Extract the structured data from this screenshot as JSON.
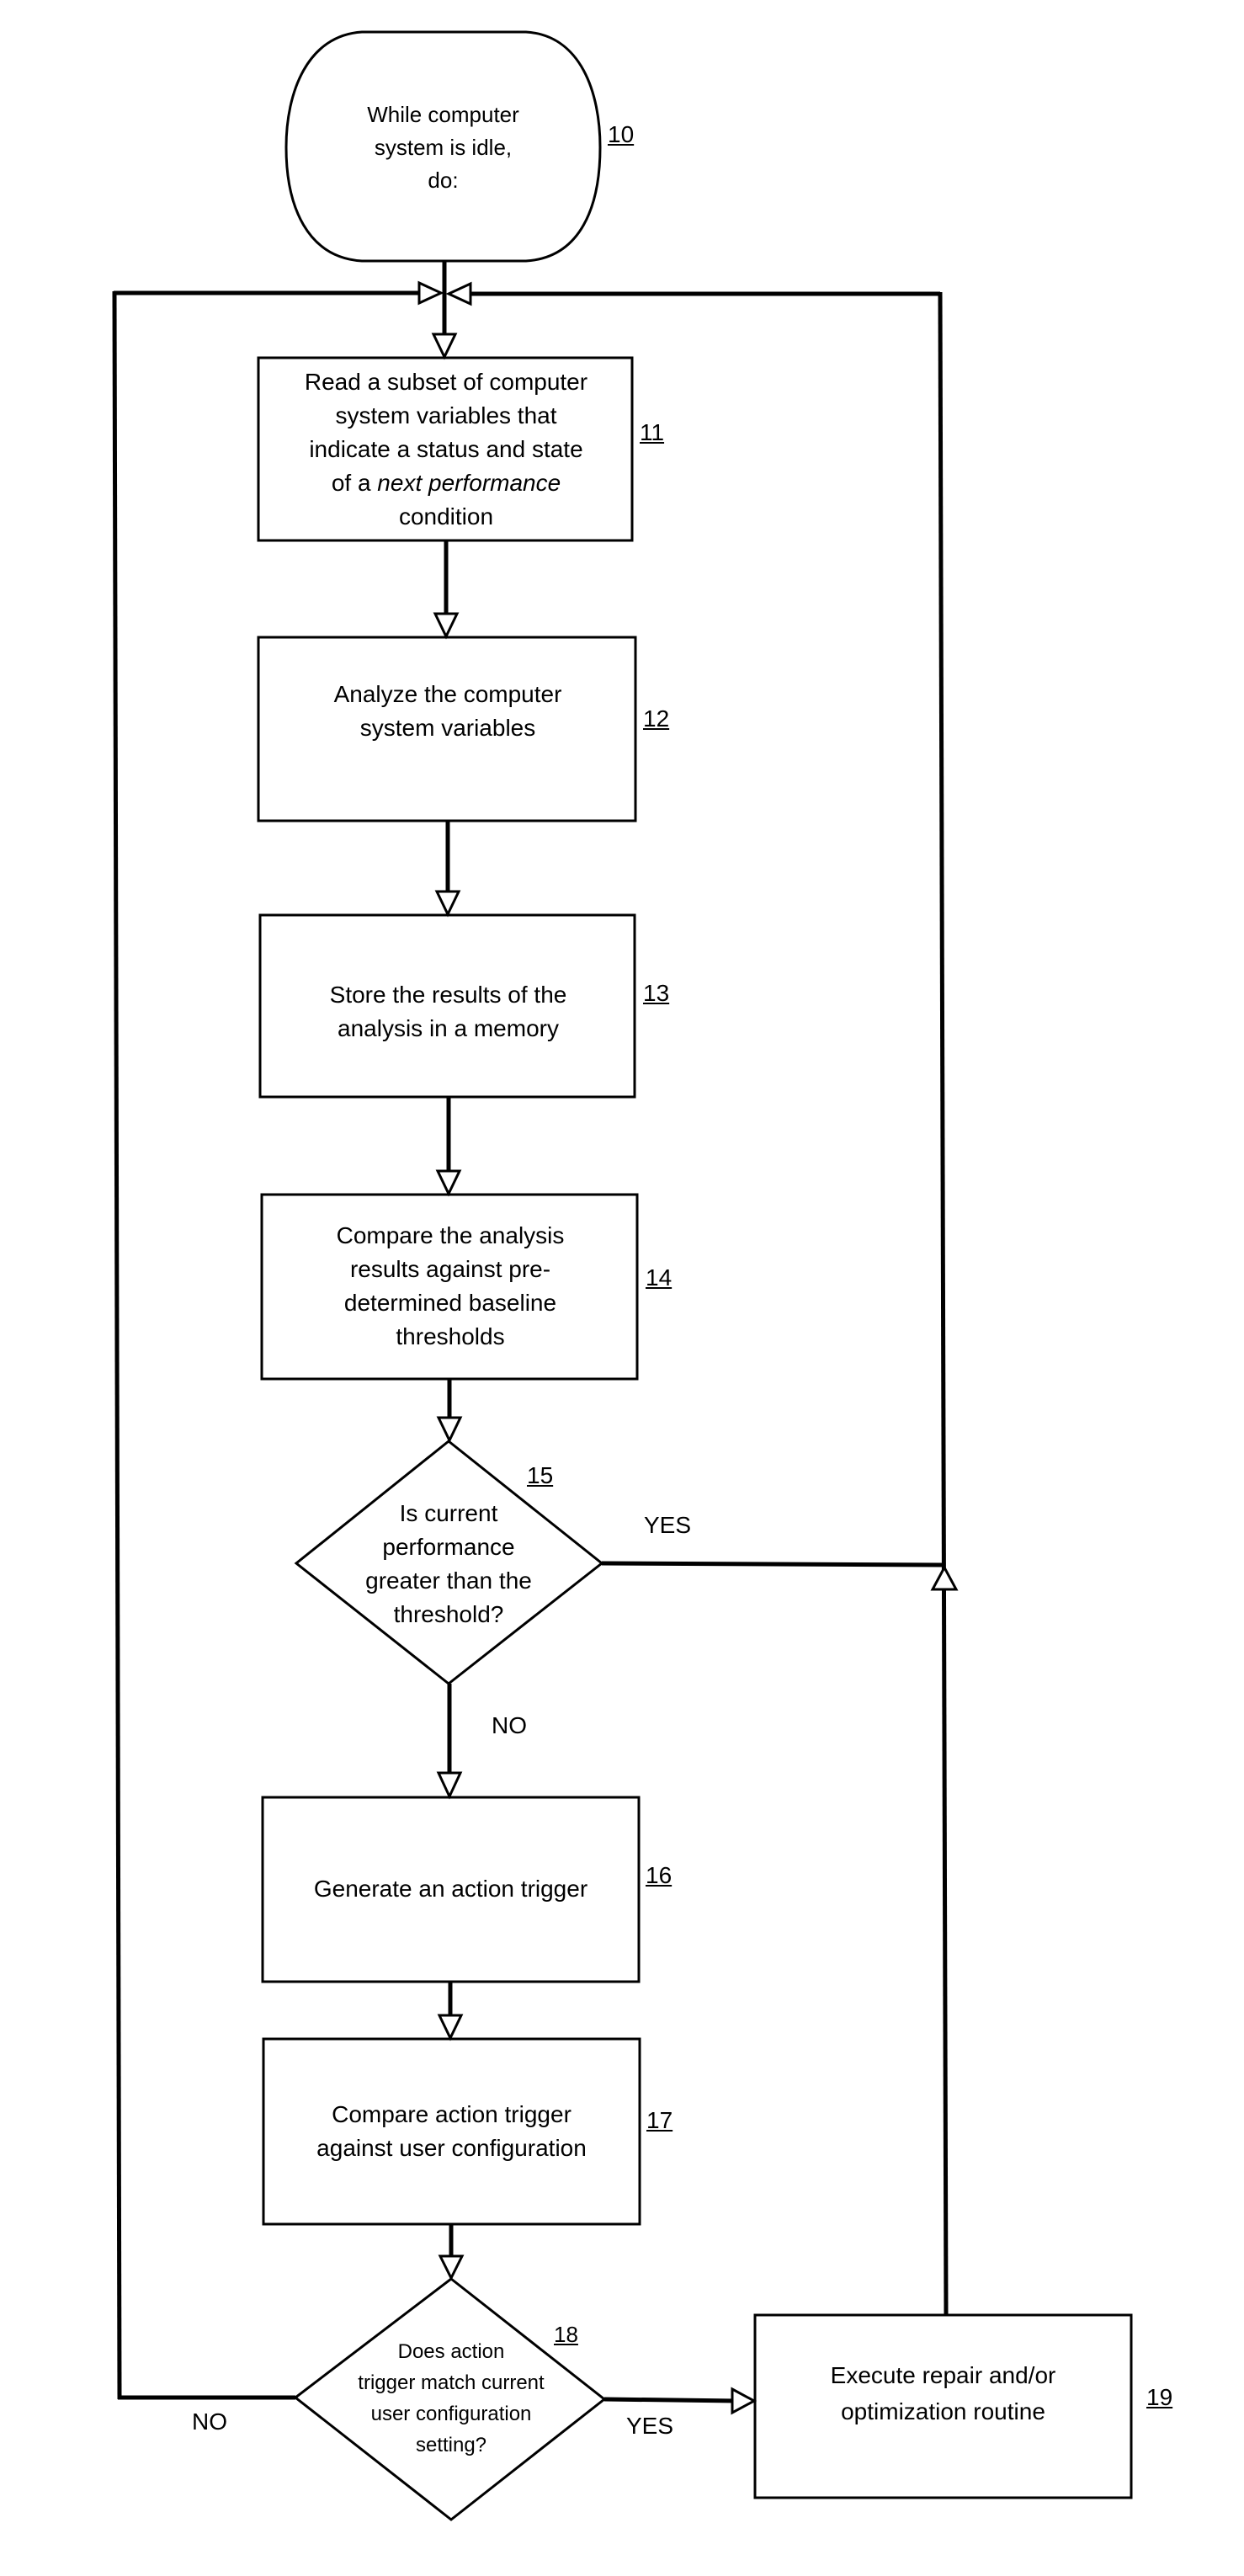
{
  "figure": {
    "colors": {
      "ink": "#000000",
      "background": "#ffffff"
    },
    "nodes": {
      "start": {
        "ref": "10",
        "shape": "terminal",
        "lines": [
          "While computer",
          "system is idle,",
          "do:"
        ]
      },
      "read_vars": {
        "ref": "11",
        "shape": "process",
        "lines": [
          "Read a subset of computer",
          "system variables that",
          "indicate a status and state",
          "of a next performance",
          "condition"
        ],
        "line4_prefix": "of a ",
        "line4_italic": "next performance"
      },
      "analyze": {
        "ref": "12",
        "shape": "process",
        "lines": [
          "Analyze the computer",
          "system variables"
        ]
      },
      "store": {
        "ref": "13",
        "shape": "process",
        "lines": [
          "Store the results of the",
          "analysis in a memory"
        ]
      },
      "compare_thresholds": {
        "ref": "14",
        "shape": "process",
        "lines": [
          "Compare the analysis",
          "results against pre-",
          "determined baseline",
          "thresholds"
        ]
      },
      "decision_performance": {
        "ref": "15",
        "shape": "decision",
        "lines": [
          "Is current",
          "performance",
          "greater than the",
          "threshold?"
        ],
        "yes_label": "YES",
        "no_label": "NO"
      },
      "generate_trigger": {
        "ref": "16",
        "shape": "process",
        "lines": [
          "Generate an action trigger"
        ]
      },
      "compare_config": {
        "ref": "17",
        "shape": "process",
        "lines": [
          "Compare action trigger",
          "against user configuration"
        ]
      },
      "decision_config": {
        "ref": "18",
        "shape": "decision",
        "lines": [
          "Does action",
          "trigger match current",
          "user configuration",
          "setting?"
        ],
        "yes_label": "YES",
        "no_label": "NO"
      },
      "execute_repair": {
        "ref": "19",
        "shape": "process",
        "lines": [
          "Execute repair and/or",
          "optimization routine"
        ]
      }
    },
    "edges": [
      {
        "from": "10",
        "to": "11"
      },
      {
        "from": "11",
        "to": "12"
      },
      {
        "from": "12",
        "to": "13"
      },
      {
        "from": "13",
        "to": "14"
      },
      {
        "from": "14",
        "to": "15"
      },
      {
        "from": "15",
        "to": "16",
        "label": "NO"
      },
      {
        "from": "15",
        "to": "11",
        "label": "YES"
      },
      {
        "from": "16",
        "to": "17"
      },
      {
        "from": "17",
        "to": "18"
      },
      {
        "from": "18",
        "to": "19",
        "label": "YES"
      },
      {
        "from": "18",
        "to": "11",
        "label": "NO"
      },
      {
        "from": "19",
        "to": "11"
      }
    ]
  }
}
